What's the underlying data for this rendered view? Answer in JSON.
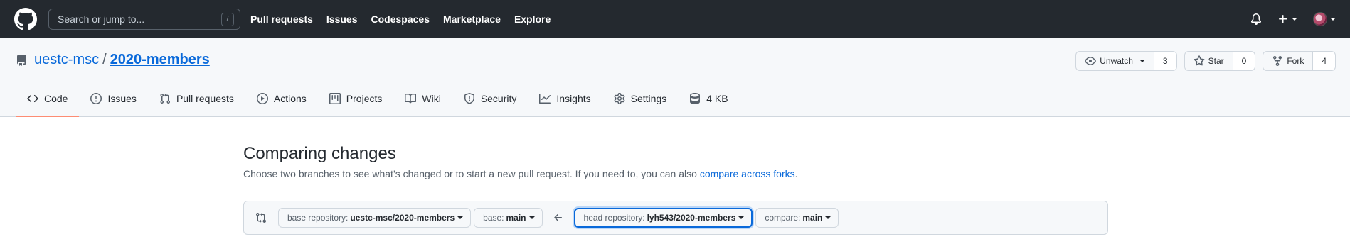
{
  "header": {
    "search_placeholder": "Search or jump to...",
    "search_shortcut": "/",
    "nav": [
      "Pull requests",
      "Issues",
      "Codespaces",
      "Marketplace",
      "Explore"
    ]
  },
  "repo": {
    "owner": "uestc-msc",
    "separator": "/",
    "name": "2020-members",
    "watch_label": "Unwatch",
    "watch_count": "3",
    "star_label": "Star",
    "star_count": "0",
    "fork_label": "Fork",
    "fork_count": "4"
  },
  "tabs": [
    {
      "label": "Code",
      "icon": "code-icon",
      "active": true
    },
    {
      "label": "Issues",
      "icon": "issue-icon"
    },
    {
      "label": "Pull requests",
      "icon": "pull-request-icon"
    },
    {
      "label": "Actions",
      "icon": "play-icon"
    },
    {
      "label": "Projects",
      "icon": "project-icon"
    },
    {
      "label": "Wiki",
      "icon": "book-icon"
    },
    {
      "label": "Security",
      "icon": "shield-icon"
    },
    {
      "label": "Insights",
      "icon": "graph-icon"
    },
    {
      "label": "Settings",
      "icon": "gear-icon"
    },
    {
      "label": "4 KB",
      "icon": "database-icon"
    }
  ],
  "compare": {
    "title": "Comparing changes",
    "description": "Choose two branches to see what’s changed or to start a new pull request. If you need to, you can also",
    "link": "compare across forks",
    "link_suffix": ".",
    "base_repo_label": "base repository:",
    "base_repo_value": "uestc-msc/2020-members",
    "base_label": "base:",
    "base_value": "main",
    "head_repo_label": "head repository:",
    "head_repo_value": "lyh543/2020-members",
    "compare_label": "compare:",
    "compare_value": "main"
  },
  "colors": {
    "header_bg": "#24292f",
    "link": "#0969da",
    "active_tab_underline": "#fd8c73",
    "focus_ring": "#0969da"
  }
}
